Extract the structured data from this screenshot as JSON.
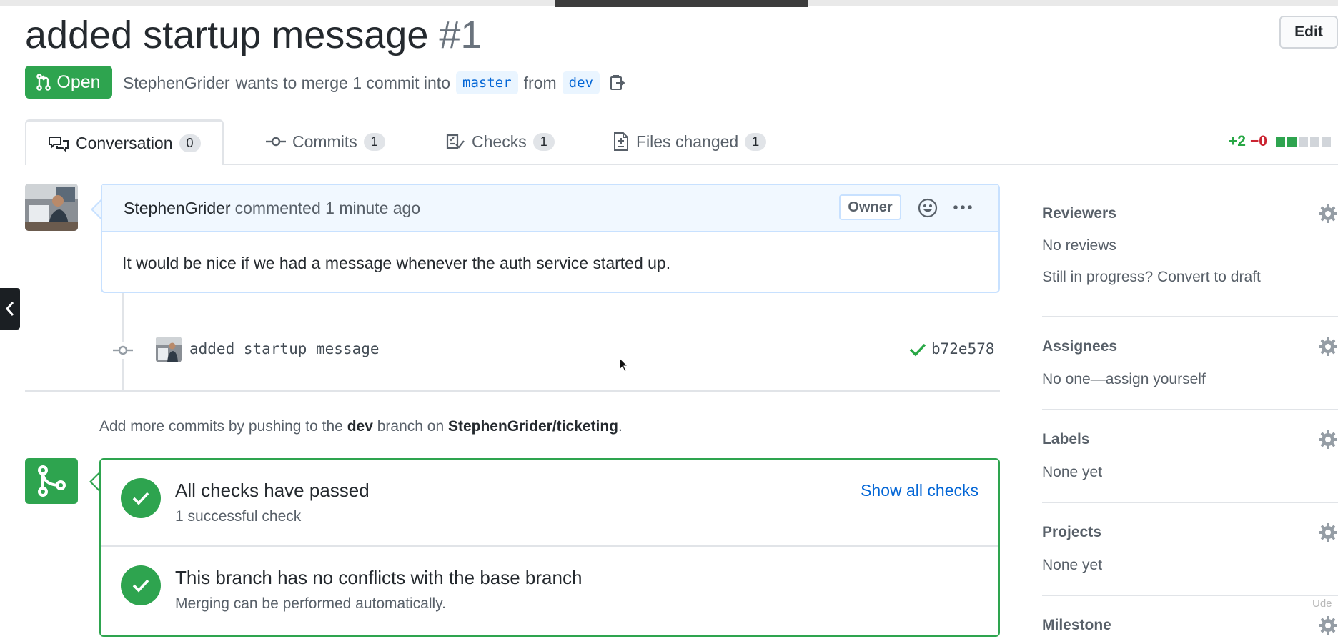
{
  "pull_request": {
    "title": "added startup message",
    "number": "#1",
    "edit_label": "Edit",
    "state": "Open",
    "meta": {
      "author": "StephenGrider",
      "wants_text": "wants to merge 1 commit into",
      "base_branch": "master",
      "from_text": "from",
      "head_branch": "dev"
    }
  },
  "tabs": [
    {
      "label": "Conversation",
      "count": "0",
      "icon": "comment-discussion-icon"
    },
    {
      "label": "Commits",
      "count": "1",
      "icon": "git-commit-icon"
    },
    {
      "label": "Checks",
      "count": "1",
      "icon": "checklist-icon"
    },
    {
      "label": "Files changed",
      "count": "1",
      "icon": "file-diff-icon"
    }
  ],
  "diffstat": {
    "additions": "+2",
    "deletions": "−0"
  },
  "comment": {
    "author": "StephenGrider",
    "action": "commented 1 minute ago",
    "role_badge": "Owner",
    "body": "It would be nice if we had a message whenever the auth service started up."
  },
  "commit": {
    "message": "added startup message",
    "sha": "b72e578",
    "status": "success"
  },
  "push_note": {
    "prefix": "Add more commits by pushing to the",
    "branch": "dev",
    "middle": "branch on",
    "repo": "StephenGrider/ticketing",
    "suffix": "."
  },
  "merge_box": {
    "checks": {
      "title": "All checks have passed",
      "subtitle": "1 successful check",
      "link": "Show all checks"
    },
    "conflicts": {
      "title": "This branch has no conflicts with the base branch",
      "subtitle": "Merging can be performed automatically."
    }
  },
  "sidebar": {
    "reviewers": {
      "heading": "Reviewers",
      "value": "No reviews",
      "draft_link": "Still in progress? Convert to draft"
    },
    "assignees": {
      "heading": "Assignees",
      "value": "No one—assign yourself"
    },
    "labels": {
      "heading": "Labels",
      "value": "None yet"
    },
    "projects": {
      "heading": "Projects",
      "value": "None yet"
    },
    "milestone": {
      "heading": "Milestone"
    }
  },
  "watermark": "Ude",
  "colors": {
    "open_green": "#2ea44f",
    "link_blue": "#0366d6",
    "deletion_red": "#cb2431",
    "comment_header_bg": "#f1f8ff"
  }
}
